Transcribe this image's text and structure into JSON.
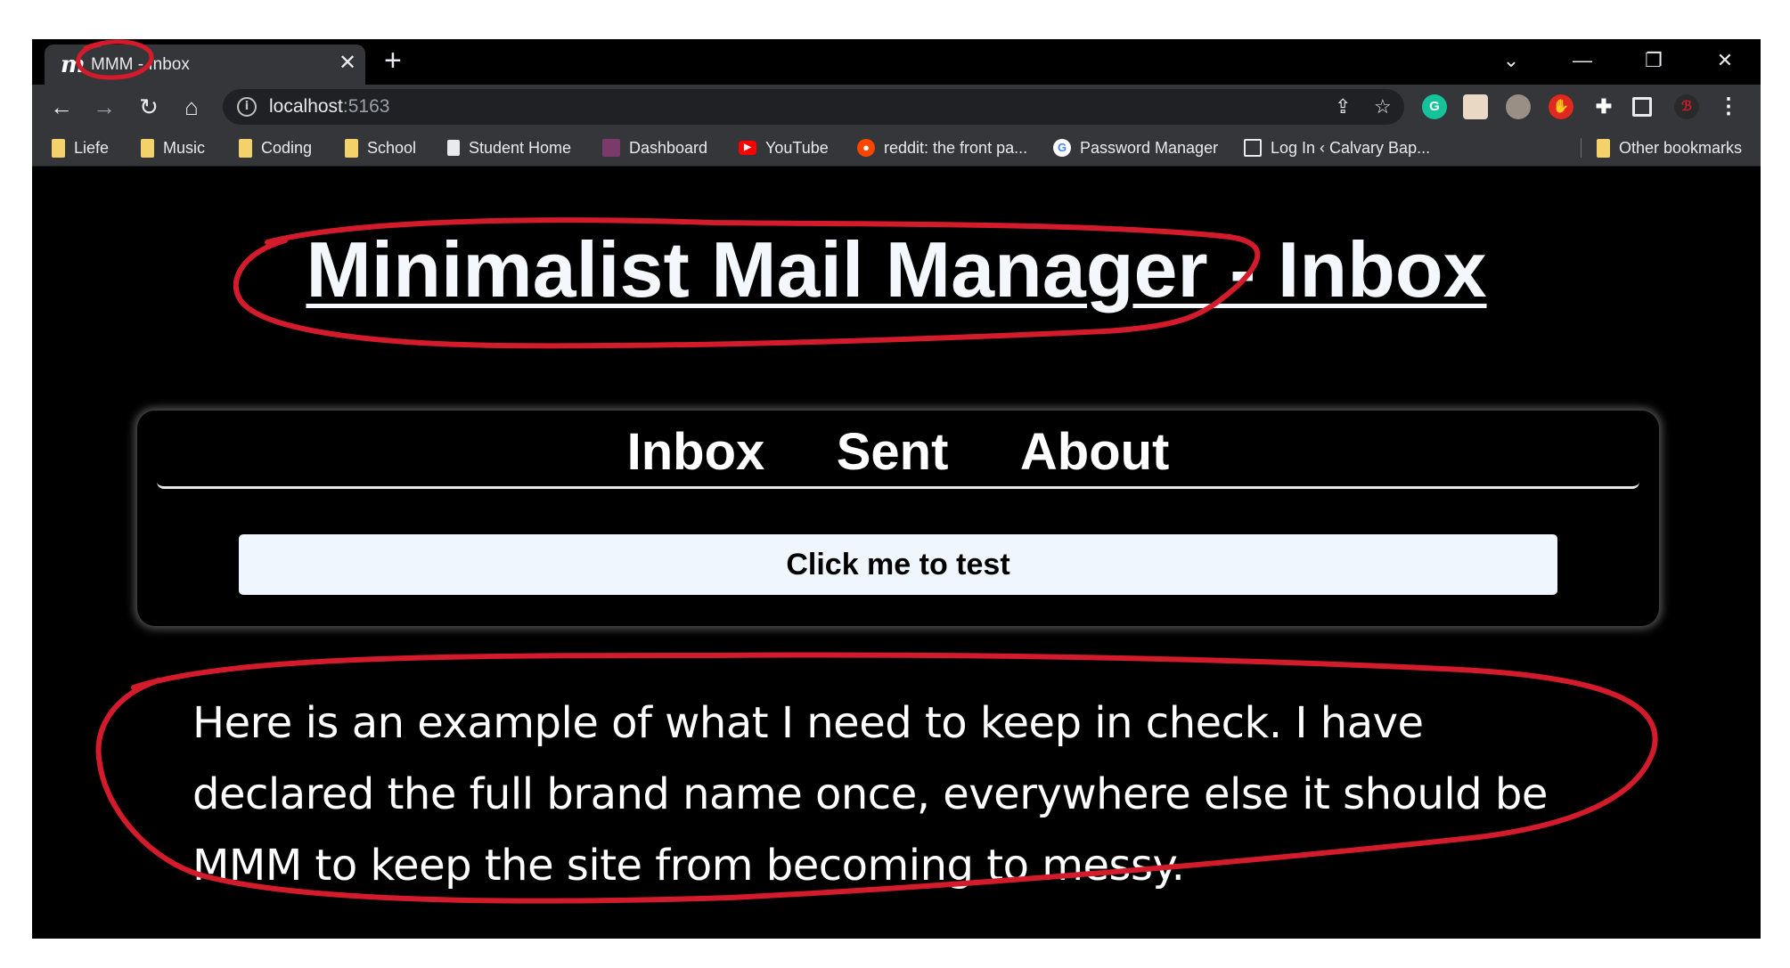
{
  "browser": {
    "tab": {
      "favicon": "m",
      "title": "MMM - Inbox"
    },
    "new_tab_label": "+",
    "window_controls": [
      "chevron-down-icon",
      "minimize-icon",
      "restore-icon",
      "close-icon"
    ],
    "url": {
      "host": "localhost",
      "port": ":5163"
    },
    "extensions": [
      "grammarly-icon",
      "profile-extension-icon",
      "mask-extension-icon",
      "ublock-icon",
      "puzzle-icon",
      "side-panel-icon",
      "avatar-icon",
      "menu-icon"
    ],
    "bookmarks": [
      {
        "label": "Liefe",
        "icon": "folder-icon"
      },
      {
        "label": "Music",
        "icon": "folder-icon"
      },
      {
        "label": "Coding",
        "icon": "folder-icon"
      },
      {
        "label": "School",
        "icon": "folder-icon"
      },
      {
        "label": "Student Home",
        "icon": "page-icon"
      },
      {
        "label": "Dashboard",
        "icon": "dashboard-icon"
      },
      {
        "label": "YouTube",
        "icon": "youtube-icon"
      },
      {
        "label": "reddit: the front pa...",
        "icon": "reddit-icon"
      },
      {
        "label": "Password Manager",
        "icon": "google-icon"
      },
      {
        "label": "Log In ‹ Calvary Bap...",
        "icon": "site-icon"
      }
    ],
    "other_bookmarks": "Other bookmarks"
  },
  "page": {
    "title": "Minimalist Mail Manager - Inbox",
    "nav": [
      "Inbox",
      "Sent",
      "About"
    ],
    "test_button": "Click me to test",
    "note": "Here is an example of what I need to keep in check. I have declared the full brand name once, everywhere else it should be MMM to keep the site from becoming to messy."
  },
  "colors": {
    "annotation": "#d41b2c",
    "page_bg": "#000000",
    "button_bg": "#f0f6fd"
  }
}
